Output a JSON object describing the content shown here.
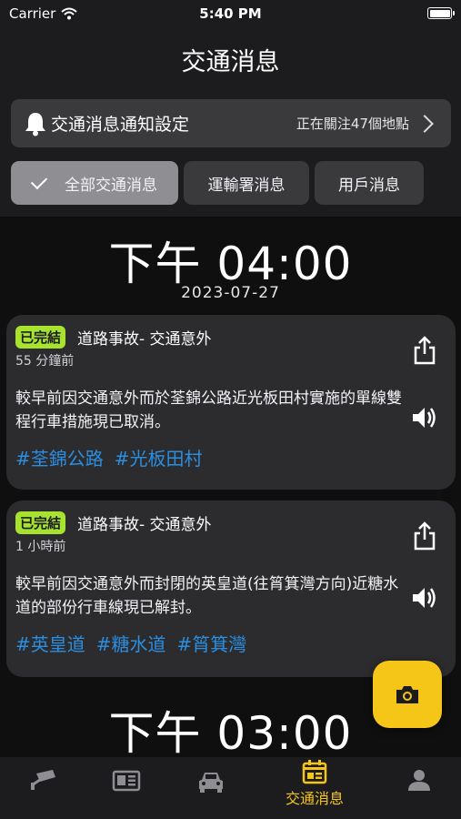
{
  "status_bar": {
    "carrier": "Carrier",
    "time": "5:40 PM"
  },
  "header": {
    "title": "交通消息"
  },
  "notification_settings": {
    "label": "交通消息通知設定",
    "status": "正在關注47個地點"
  },
  "filter_tabs": [
    {
      "label": "全部交通消息",
      "selected": true
    },
    {
      "label": "運輸署消息",
      "selected": false
    },
    {
      "label": "用戶消息",
      "selected": false
    }
  ],
  "feed": {
    "groups": [
      {
        "time": "下午 04:00",
        "date": "2023-07-27",
        "items": [
          {
            "badge": "已完結",
            "title": "道路事故- 交通意外",
            "ago": "55 分鐘前",
            "body": "較早前因交通意外而於荃錦公路近光板田村實施的單線雙程行車措施現已取消。",
            "tags": [
              "#荃錦公路",
              "#光板田村"
            ]
          },
          {
            "badge": "已完結",
            "title": "道路事故- 交通意外",
            "ago": "1 小時前",
            "body": "較早前因交通意外而封閉的英皇道(往筲箕灣方向)近糖水道的部份行車線現已解封。",
            "tags": [
              "#英皇道",
              "#糖水道",
              "#筲箕灣"
            ]
          }
        ]
      },
      {
        "time": "下午 03:00"
      }
    ]
  },
  "tab_bar": {
    "items": [
      {
        "icon": "traffic-camera-icon"
      },
      {
        "icon": "news-icon"
      },
      {
        "icon": "car-icon"
      },
      {
        "icon": "traffic-news-icon",
        "label": "交通消息",
        "active": true
      },
      {
        "icon": "person-icon"
      }
    ]
  },
  "colors": {
    "accent": "#f5c518",
    "badge_green": "#a6e22e",
    "tag_blue": "#2c8ee0",
    "card_bg": "#2c2c2e",
    "feed_bg": "#0f0f0f"
  }
}
